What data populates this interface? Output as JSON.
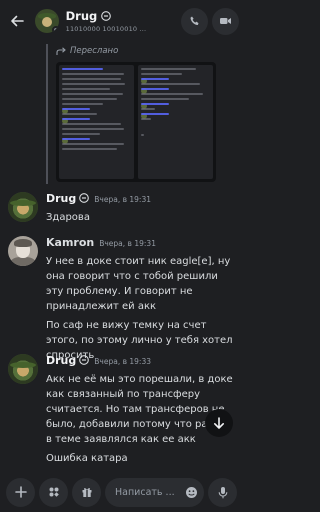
{
  "header": {
    "name": "Drug",
    "subtitle": "11010000 10010010 ...",
    "back_icon": "arrow-left-icon",
    "tag_icon": "minus-circle-icon"
  },
  "forwarded": {
    "label": "Переслано"
  },
  "messages": [
    {
      "author": "Drug",
      "time": "Вчера, в 19:31",
      "lines": [
        "Здарова"
      ]
    },
    {
      "author": "Kamron",
      "time": "Вчера, в 19:31",
      "lines": [
        "У нее в доке стоит ник eagle[e], ну она говорит что с тобой решили эту проблему. И говорит не принадлежит ей акк",
        "По саф не вижу темку на счет этого, по этому лично у тебя хотел спросить"
      ]
    },
    {
      "author": "Drug",
      "time": "Вчера, в 19:33",
      "lines": [
        "Акк не её мы это порешали, в доке как связанный по трансферу считается. Но там трансферов не было, добавили потому что ранее в теме заявлялся как ее акк",
        "Ошибка катара"
      ]
    }
  ],
  "composer": {
    "placeholder": "Написать ...",
    "buttons": [
      "plus-icon",
      "apps-icon",
      "gift-icon",
      "emoji-icon",
      "microphone-icon"
    ]
  },
  "colors": {
    "background": "#1e1f22",
    "surface": "#2b2d31",
    "text": "#dbdee1",
    "muted": "#949ba4",
    "accent": "#5865f2"
  }
}
